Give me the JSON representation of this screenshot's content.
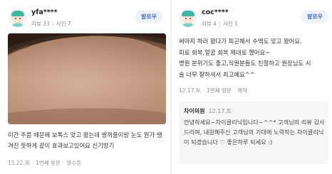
{
  "reviews": [
    {
      "user": "yfa****",
      "review_count": "리뷰 33",
      "photo_count": "사진 7",
      "follow_label": "팔로우",
      "text": "미간 주름 때문에 보톡스 맞고 왔는데 쌍꺼풀이랑 눈도 뭔가 땡겨진 듯하게 같이 효과보고있어요 신기방기",
      "date": "11.22.화",
      "visit": "1번째 방문",
      "receipt": "영수증"
    },
    {
      "user": "coc****",
      "review_count": "리뷰 4",
      "photo_count": "사진 1",
      "follow_label": "팔로우",
      "text_lines": [
        "써마지 하러 왔다가 피곤해서 수액도 맞고 왔어요.",
        "피로 회복,얼굴 회복 제대로 했어요~",
        "병원 분위기도 좋고,직원분들도 친절하고 원장님도 시",
        "술 너무 잘하셔서 최고예요^^"
      ],
      "date": "12.17.토",
      "visit": "1번째 방문",
      "receipt": "예약",
      "reply": {
        "name": "차이의원",
        "date": "12.17.토",
        "text": "안녕하세요~차이클리닉입니다~^^* 고객님의 리뷰 감사드리며, 내원해주신 고객님의 기대에 노력하는 차이클리닉이 되겠습니다 ♡ 좋은하루 되세요 :)"
      }
    }
  ],
  "colors": {
    "follow_text": "#4c6fbf",
    "follow_bg": "#eef2fa",
    "meta_text": "#8f8f8f",
    "reply_bg": "#f6f6f7"
  }
}
